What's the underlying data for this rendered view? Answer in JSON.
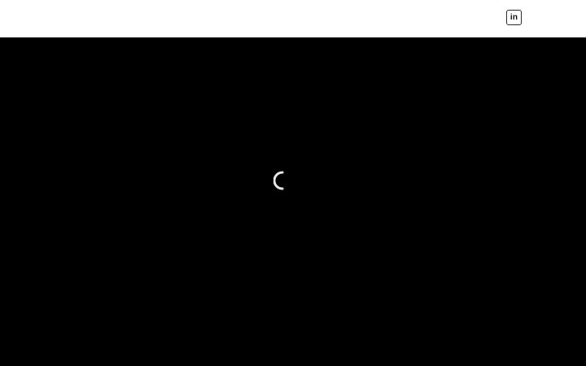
{
  "header": {
    "social": {
      "linkedin_glyph": "in",
      "icon": "linkedin-icon"
    }
  },
  "video": {
    "state": "loading",
    "icon": "loading-spinner-icon"
  },
  "colors": {
    "header_bg": "#ffffff",
    "video_bg": "#000000",
    "spinner": "#e6e6e6",
    "icon_border": "#2b2b2b"
  }
}
